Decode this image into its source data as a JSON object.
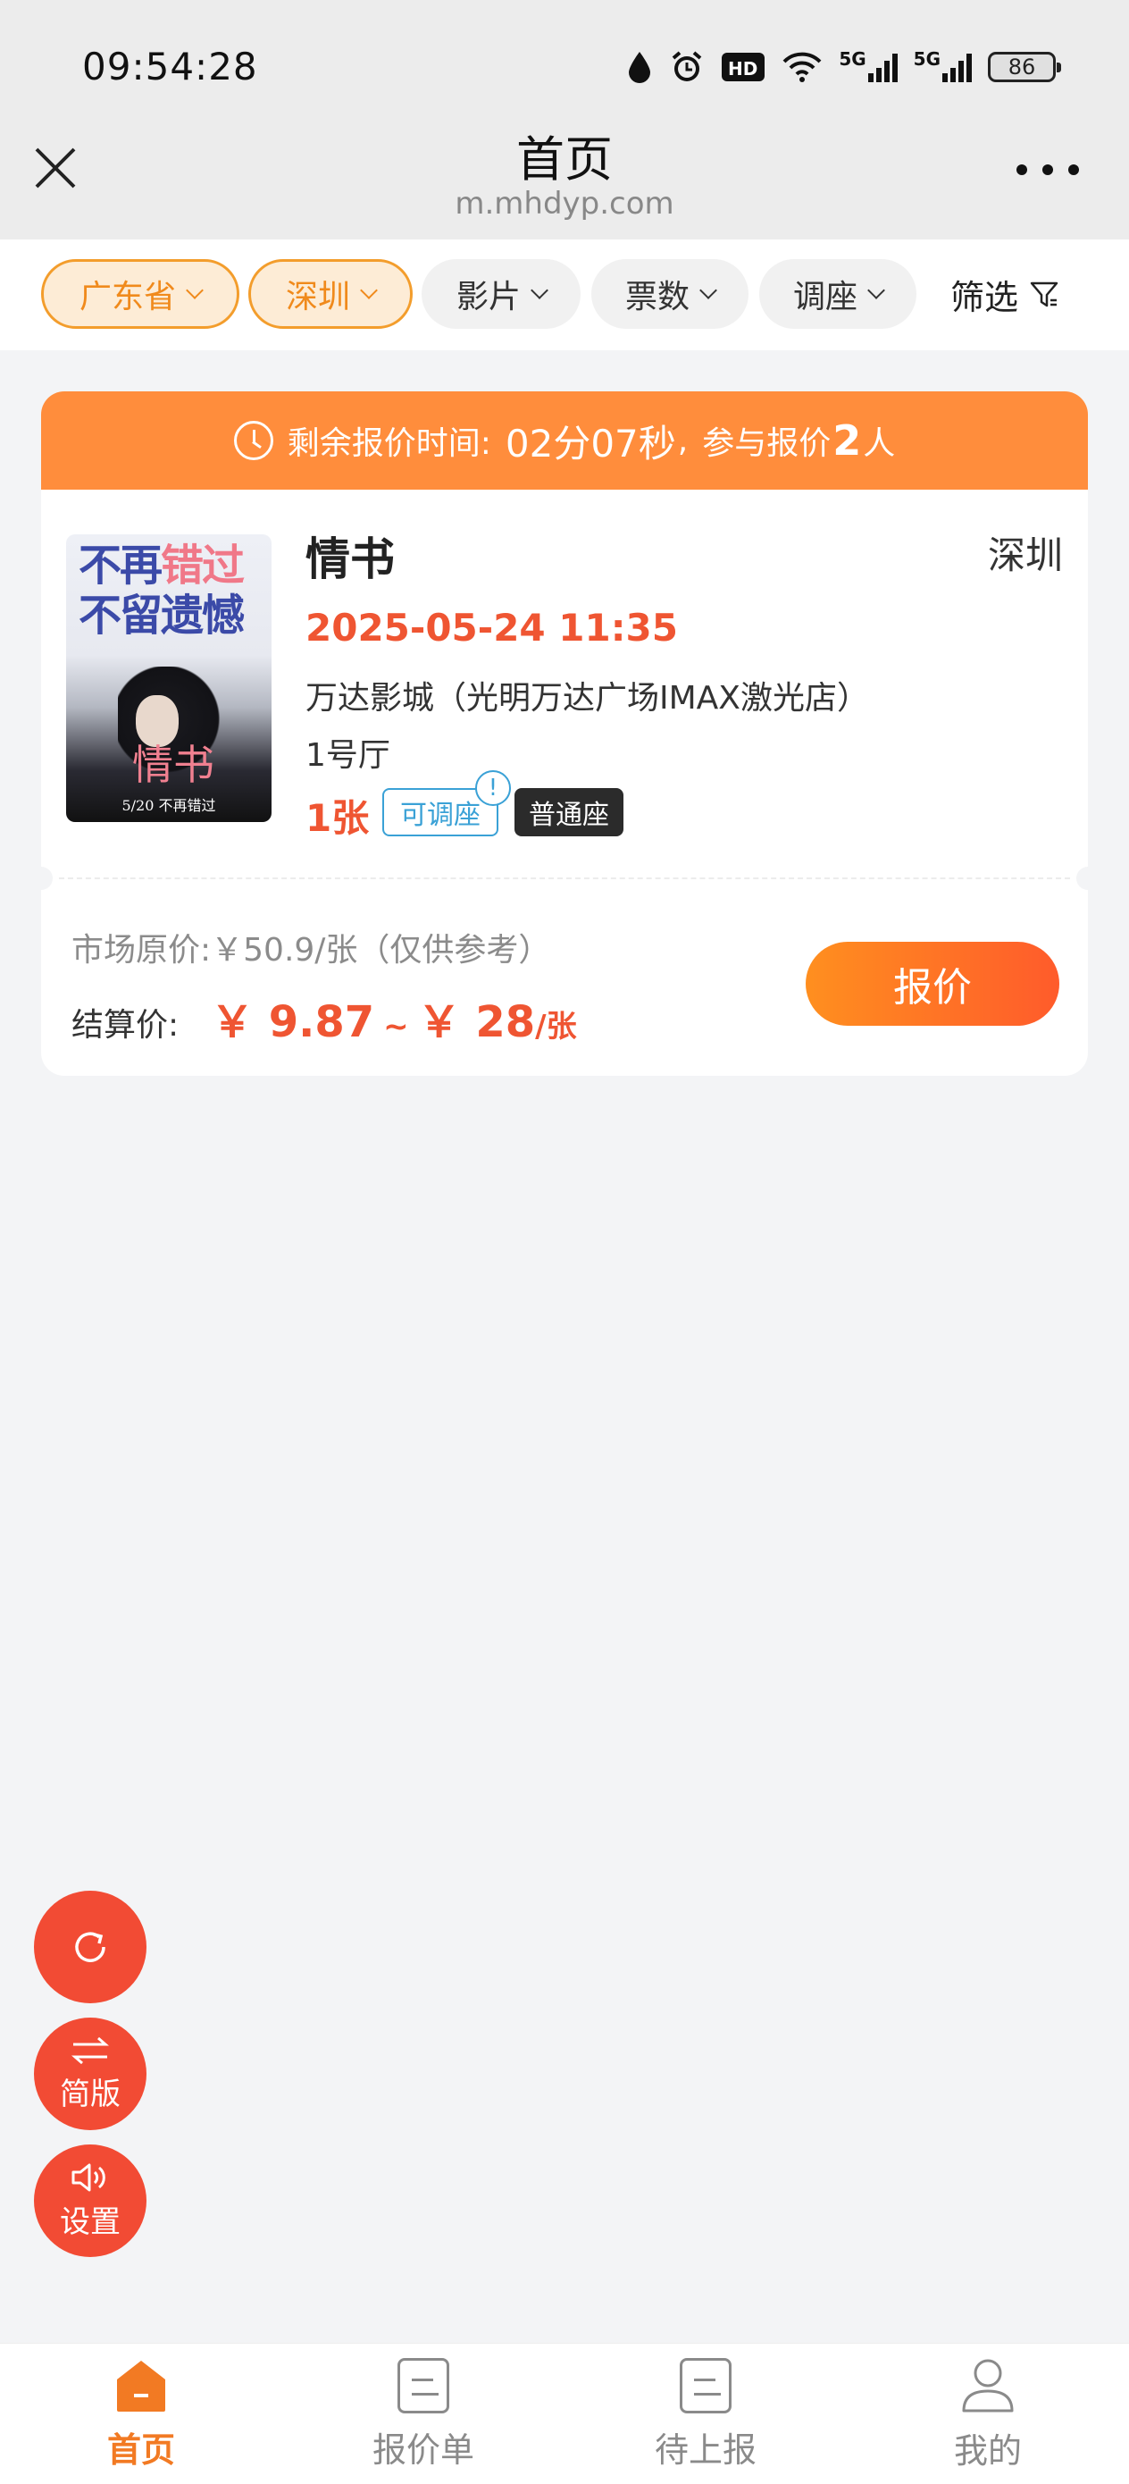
{
  "status_bar": {
    "time": "09:54:28",
    "icons": [
      "drop-icon",
      "alarm-icon",
      "hd-icon",
      "wifi-icon",
      "5g-signal-icon",
      "5g-signal-icon"
    ],
    "hd_label": "HD",
    "network_label": "5G",
    "battery": "86"
  },
  "header": {
    "title": "首页",
    "url": "m.mhdyp.com"
  },
  "filters": [
    {
      "label": "广东省",
      "active": true
    },
    {
      "label": "深圳",
      "active": true
    },
    {
      "label": "影片",
      "active": false
    },
    {
      "label": "票数",
      "active": false
    },
    {
      "label": "调座",
      "active": false
    }
  ],
  "filter_button": {
    "label": "筛选"
  },
  "order": {
    "banner": {
      "prefix": "剩余报价时间:",
      "countdown": "02分07秒",
      "sep": ",",
      "participants_prefix": "参与报价",
      "participants_count": "2",
      "participants_suffix": "人"
    },
    "poster": {
      "line1_a": "不再",
      "line1_b": "错过",
      "line2_a": "不留",
      "line2_b": "遗憾",
      "title": "情书",
      "date": "5/20 不再错过"
    },
    "movie_title": "情书",
    "city": "深圳",
    "show_time": "2025-05-24 11:35",
    "cinema": "万达影城（光明万达广场IMAX激光店）",
    "hall": "1号厅",
    "quantity": "1张",
    "tag_adjust": "可调座",
    "info_mark": "!",
    "tag_seat": "普通座",
    "market_price": "市场原价:￥50.9/张（仅供参考）",
    "settle_label": "结算价:",
    "settle_min": "￥ 9.87",
    "settle_sep": "~",
    "settle_max": "￥ 28",
    "settle_unit": "/张",
    "quote_button": "报价"
  },
  "fabs": {
    "refresh_icon": "refresh-icon",
    "simple_label": "简版",
    "settings_label": "设置"
  },
  "bottom_nav": [
    {
      "label": "首页",
      "icon": "home-icon",
      "active": true
    },
    {
      "label": "报价单",
      "icon": "document-icon",
      "active": false
    },
    {
      "label": "待上报",
      "icon": "document-icon",
      "active": false
    },
    {
      "label": "我的",
      "icon": "user-icon",
      "active": false
    }
  ],
  "colors": {
    "accent": "#ff8d3c",
    "price": "#ef5532",
    "chip_active_bg": "#fdecd6",
    "chip_active_border": "#f39d2c",
    "fab": "#f24b34",
    "tag_blue": "#3aa1d6"
  }
}
